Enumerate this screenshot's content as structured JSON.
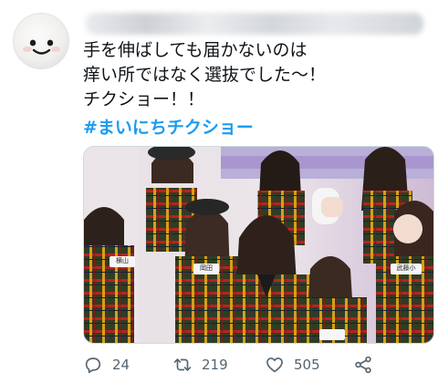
{
  "tweet": {
    "text_lines": [
      "手を伸ばしても届かないのは",
      "痒い所ではなく選抜でした〜！",
      "チクショー！！"
    ],
    "hashtag": "#まいにちチクショー"
  },
  "media": {
    "name_badges": [
      "横山",
      "岡田",
      "武藤小"
    ]
  },
  "actions": {
    "reply": {
      "icon": "comment-icon",
      "count": "24"
    },
    "retweet": {
      "icon": "retweet-icon",
      "count": "219"
    },
    "like": {
      "icon": "heart-icon",
      "count": "505"
    },
    "share": {
      "icon": "share-icon"
    }
  },
  "colors": {
    "hashtag": "#1d9bf0",
    "text": "#0f1419",
    "muted": "#536471"
  }
}
